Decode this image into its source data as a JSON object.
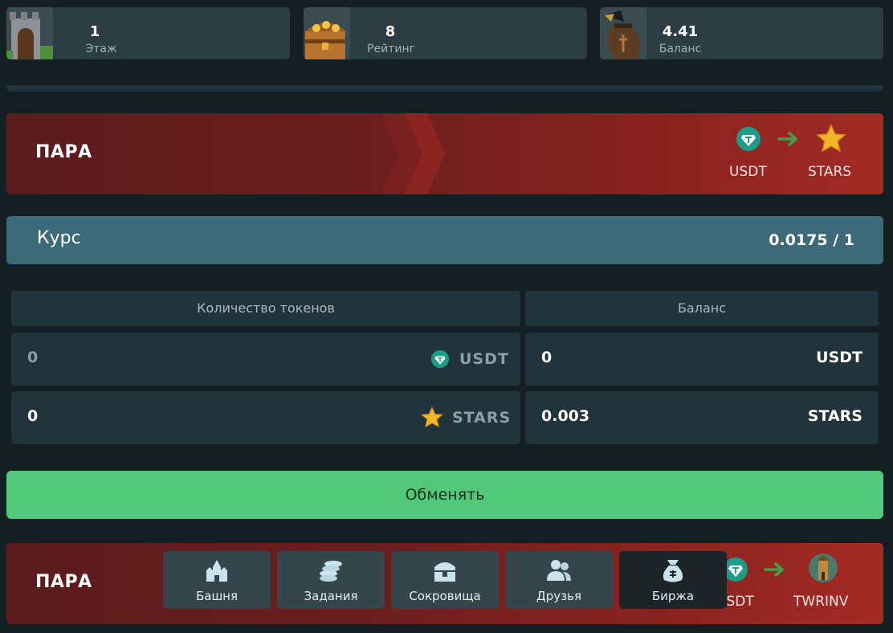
{
  "stats": [
    {
      "value": "1",
      "label": "Этаж",
      "icon": "tower-icon"
    },
    {
      "value": "8",
      "label": "Рейтинг",
      "icon": "treasure-chest-icon"
    },
    {
      "value": "4.41",
      "label": "Баланс",
      "icon": "money-bag-icon"
    }
  ],
  "pair_top": {
    "title": "ПАРА",
    "from": "USDT",
    "to": "STARS"
  },
  "rate": {
    "label": "Курс",
    "value": "0.0175 / 1"
  },
  "exchange": {
    "tokens_header": "Количество токенов",
    "balance_header": "Баланс",
    "rows": [
      {
        "amount": "0",
        "unit": "USDT",
        "balance": "0",
        "balance_unit": "USDT"
      },
      {
        "amount": "0",
        "unit": "STARS",
        "balance": "0.003",
        "balance_unit": "STARS"
      }
    ]
  },
  "swap_button": "Обменять",
  "pair_bottom": {
    "title": "ПАРА",
    "from": "USDT",
    "to": "TWRINV"
  },
  "nav": [
    {
      "label": "Башня",
      "icon": "castle-icon",
      "active": false
    },
    {
      "label": "Задания",
      "icon": "coins-icon",
      "active": false
    },
    {
      "label": "Сокровища",
      "icon": "chest-icon",
      "active": false
    },
    {
      "label": "Друзья",
      "icon": "friends-icon",
      "active": false
    },
    {
      "label": "Биржа",
      "icon": "bag-icon",
      "active": true
    }
  ],
  "colors": {
    "background": "#141f23",
    "card": "#2b3d42",
    "banner": "#a42a24",
    "rate_bar": "#3d6a78",
    "swap": "#52c97a",
    "usdt": "#1a9e8a",
    "star": "#f3b62a"
  }
}
